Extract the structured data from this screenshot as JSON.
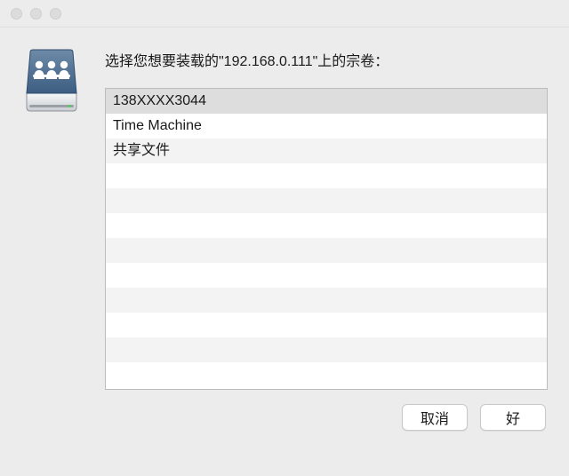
{
  "prompt": "选择您想要装载的\"192.168.0.111\"上的宗卷：",
  "volumes": [
    {
      "label": "138XXXX3044",
      "selected": true
    },
    {
      "label": "Time Machine",
      "selected": false
    },
    {
      "label": "共享文件",
      "selected": false
    }
  ],
  "list_total_rows": 12,
  "buttons": {
    "cancel": "取消",
    "ok": "好"
  },
  "icon": {
    "name": "network-share-drive-icon"
  }
}
